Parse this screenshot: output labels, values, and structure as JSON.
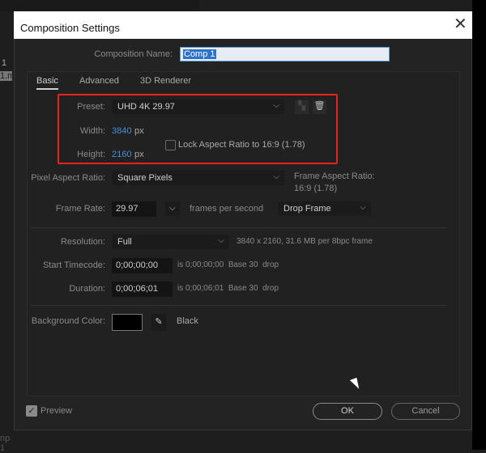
{
  "background": {
    "left_labels": [
      "1",
      "1.m"
    ],
    "bottom_label": "np 1"
  },
  "dialog": {
    "title": "Composition Settings",
    "comp_name_label": "Composition Name:",
    "comp_name_value": "Comp 1",
    "tabs": [
      "Basic",
      "Advanced",
      "3D Renderer"
    ],
    "active_tab": "Basic",
    "preset_label": "Preset:",
    "preset_value": "UHD 4K 29.97",
    "width_label": "Width:",
    "width_value": "3840",
    "width_unit": "px",
    "height_label": "Height:",
    "height_value": "2160",
    "height_unit": "px",
    "lock_aspect_label": "Lock Aspect Ratio to 16:9 (1.78)",
    "lock_aspect_checked": false,
    "par_label": "Pixel Aspect Ratio:",
    "par_value": "Square Pixels",
    "far_label": "Frame Aspect Ratio:",
    "far_value": "16:9 (1.78)",
    "frame_rate_label": "Frame Rate:",
    "frame_rate_value": "29.97",
    "fps_label": "frames per second",
    "drop_frame_value": "Drop Frame",
    "resolution_label": "Resolution:",
    "resolution_value": "Full",
    "resolution_info": "3840 x 2160, 31.6 MB per 8bpc frame",
    "start_tc_label": "Start Timecode:",
    "start_tc_value": "0;00;00;00",
    "start_tc_info": "is 0;00;00;00  Base 30  drop",
    "duration_label": "Duration:",
    "duration_value": "0;00;06;01",
    "duration_info": "is 0;00;06;01  Base 30  drop",
    "bg_color_label": "Background Color:",
    "bg_color_value": "#000000",
    "bg_color_name": "Black",
    "preview_label": "Preview",
    "preview_checked": true,
    "ok_label": "OK",
    "cancel_label": "Cancel",
    "highlight_color": "#e8231e"
  }
}
